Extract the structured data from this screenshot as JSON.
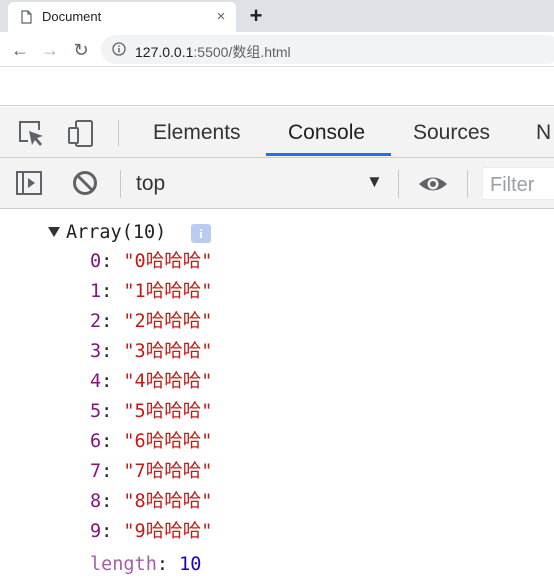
{
  "browser": {
    "tab_title": "Document",
    "close_glyph": "×",
    "newtab_glyph": "+",
    "url_host": "127.0.0.1",
    "url_rest": ":5500/数组.html",
    "back_glyph": "←",
    "forward_glyph": "→",
    "reload_glyph": "↻"
  },
  "devtools": {
    "tabs": [
      "Elements",
      "Console",
      "Sources",
      "N"
    ],
    "active_tab": "Console",
    "context": "top",
    "context_arrow": "▼",
    "filter_placeholder": "Filter",
    "icons": [
      "inspect-element-icon",
      "device-toolbar-icon",
      "sidebar-toggle-icon",
      "clear-console-icon",
      "eye-icon"
    ]
  },
  "console": {
    "array_header": "Array(10)",
    "info_badge": "i",
    "entries": [
      {
        "key": "0",
        "value": "\"0哈哈哈\""
      },
      {
        "key": "1",
        "value": "\"1哈哈哈\""
      },
      {
        "key": "2",
        "value": "\"2哈哈哈\""
      },
      {
        "key": "3",
        "value": "\"3哈哈哈\""
      },
      {
        "key": "4",
        "value": "\"4哈哈哈\""
      },
      {
        "key": "5",
        "value": "\"5哈哈哈\""
      },
      {
        "key": "6",
        "value": "\"6哈哈哈\""
      },
      {
        "key": "7",
        "value": "\"7哈哈哈\""
      },
      {
        "key": "8",
        "value": "\"8哈哈哈\""
      },
      {
        "key": "9",
        "value": "\"9哈哈哈\""
      }
    ],
    "length_key": "length",
    "length_value": "10"
  },
  "colors": {
    "accent": "#1a73e8",
    "key": "#881280",
    "string": "#c41a16",
    "number": "#1c00cf"
  }
}
